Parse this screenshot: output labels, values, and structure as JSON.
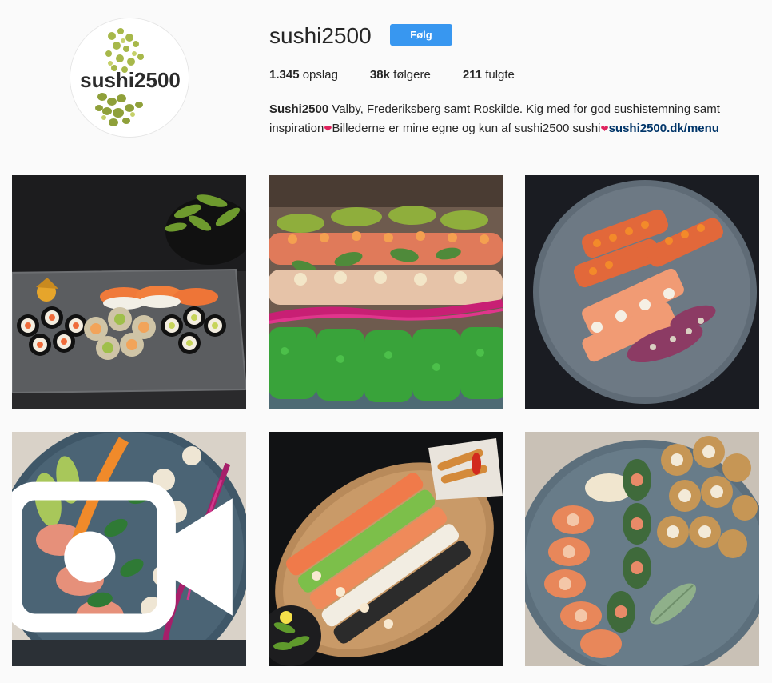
{
  "profile": {
    "avatar_logo_text": "sushi2500",
    "username": "sushi2500",
    "follow_label": "Følg",
    "stats": {
      "posts_count": "1.345",
      "posts_label": "opslag",
      "followers_count": "38k",
      "followers_label": "følgere",
      "following_count": "211",
      "following_label": "fulgte"
    },
    "bio": {
      "name": "Sushi2500",
      "text_line1": " Valby, Frederiksberg samt Roskilde. Kig med for god sushistemning samt",
      "text_line2_a": "inspiration",
      "text_line2_b": "Billederne er mine egne og kun af sushi2500 sushi",
      "heart": "❤",
      "link": "sushi2500.dk/menu"
    }
  },
  "posts": [
    {
      "kind": "image",
      "subject": "sushi assortment on dark slate with edamame bowl"
    },
    {
      "kind": "image",
      "subject": "green dragon rolls with pink garnish"
    },
    {
      "kind": "image",
      "subject": "salmon roe topped rolls on blue plate"
    },
    {
      "kind": "video",
      "subject": "rolls with avocado and roe on dark plate"
    },
    {
      "kind": "image",
      "subject": "sushi platter on wooden board with tempura"
    },
    {
      "kind": "image",
      "subject": "salmon and tempura rolls on blue plate"
    }
  ],
  "icons": {
    "video": "video-camera-icon"
  },
  "colors": {
    "accent": "#3897f0",
    "link": "#003569",
    "heart": "#e0245e",
    "background": "#fafafa"
  }
}
